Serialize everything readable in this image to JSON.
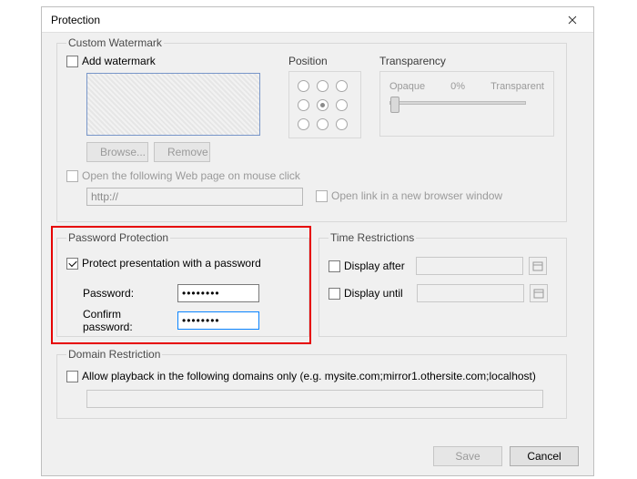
{
  "dialog_title": "Protection",
  "watermark": {
    "legend": "Custom Watermark",
    "add_label": "Add watermark",
    "add_checked": false,
    "browse_label": "Browse...",
    "remove_label": "Remove",
    "position_label": "Position",
    "transparency": {
      "label": "Transparency",
      "opaque": "Opaque",
      "percent": "0%",
      "transparent": "Transparent"
    },
    "open_web_label": "Open the following Web page on mouse click",
    "open_web_checked": false,
    "url_value": "http://",
    "open_new_label": "Open link in a new browser window",
    "open_new_checked": false
  },
  "password": {
    "legend": "Password Protection",
    "protect_label": "Protect presentation with a password",
    "protect_checked": true,
    "password_label": "Password:",
    "password_value": "••••••••",
    "confirm_label": "Confirm password:",
    "confirm_value": "••••••••"
  },
  "time": {
    "legend": "Time Restrictions",
    "after_label": "Display after",
    "after_checked": false,
    "until_label": "Display until",
    "until_checked": false
  },
  "domain": {
    "legend": "Domain Restriction",
    "allow_label": "Allow playback in the following domains only (e.g. mysite.com;mirror1.othersite.com;localhost)",
    "allow_checked": false,
    "domains_value": ""
  },
  "buttons": {
    "save": "Save",
    "cancel": "Cancel"
  }
}
